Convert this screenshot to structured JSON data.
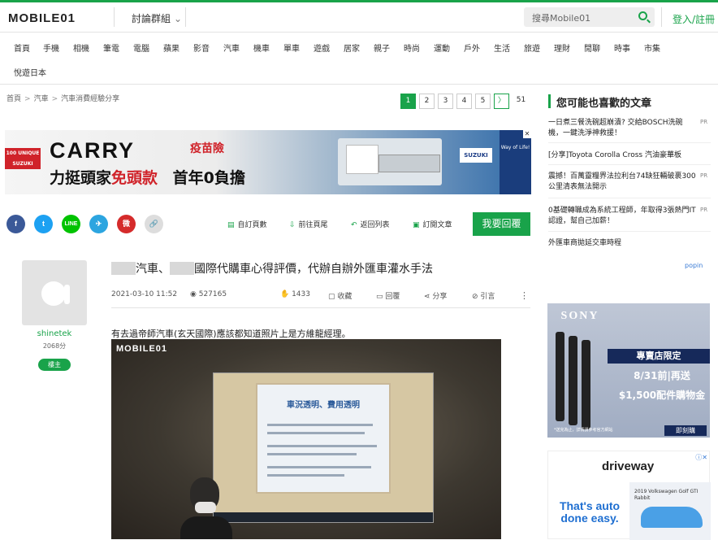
{
  "header": {
    "logo": "MOBILE01",
    "forum_label": "討論群組",
    "search_placeholder": "搜尋Mobile01",
    "login": "登入/註冊"
  },
  "nav": {
    "row1": [
      "首頁",
      "手機",
      "相機",
      "筆電",
      "電腦",
      "蘋果",
      "影音",
      "汽車",
      "機車",
      "單車",
      "遊戲",
      "居家",
      "親子",
      "時尚",
      "運動",
      "戶外",
      "生活",
      "旅遊",
      "理財",
      "閒聊",
      "時事",
      "市集"
    ],
    "row2": [
      "悅遊日本"
    ]
  },
  "breadcrumb": [
    "首頁",
    "汽車",
    "汽車消費經驗分享"
  ],
  "pagination": {
    "pages": [
      "1",
      "2",
      "3",
      "4",
      "5"
    ],
    "next": "〉",
    "last": "51",
    "active": "1"
  },
  "ad_banner": {
    "badge": "100 UNIQUE SUZUKI",
    "headline": "CARRY",
    "sub_a": "力挺頭家",
    "sub_b": "免頭款",
    "sub_c": "首年0負擔",
    "tag": "疫苗險",
    "brand": "SUZUKI",
    "side": "Way of Life!"
  },
  "share": [
    "f",
    "t",
    "LINE",
    "✈",
    "微",
    "🔗"
  ],
  "actions": {
    "custom_page": "自訂頁數",
    "goto_floor": "前往頁尾",
    "back_list": "返回列表",
    "subscribe": "訂閱文章",
    "reply": "我要回覆"
  },
  "author": {
    "name": "shinetek",
    "points": "2068分",
    "role": "樓主"
  },
  "post": {
    "title_a": "汽車、",
    "title_b": "國際代購車心得評價，代辦自辦外匯車灌水手法",
    "date": "2021-03-10 11:52",
    "views": "527165",
    "likes": "1433",
    "favorite": "收藏",
    "reply": "回覆",
    "share": "分享",
    "quote": "引言",
    "text": "有去過帝師汽車(玄天國際)應該都知道照片上是方維龍經理。",
    "photo_watermark": "MOBILE01",
    "slide_title": "車況透明、費用透明"
  },
  "sidebar": {
    "title": "您可能也喜歡的文章",
    "items": [
      {
        "text": "一日煮三餐洗碗超崩潰? 交給BOSCH洗碗機，一鍵洗淨神救援！",
        "pr": "PR"
      },
      {
        "text": "[分享]Toyota Corolla Cross 汽油豪華板",
        "pr": ""
      },
      {
        "text": "震撼！百萬靈糧界法拉利台74缺狂輛破裹300公里清表無法開示",
        "pr": "PR"
      },
      {
        "text": "0基礎轉職成為系統工程師，年取得3張熱門IT認證，幫自己加薪！",
        "pr": "PR"
      },
      {
        "text": "外匯車商拋延交車時程",
        "pr": ""
      }
    ],
    "popin": "popin"
  },
  "ads": {
    "sony": {
      "logo": "SONY",
      "ribbon": "專賣店限定",
      "line1": "8/31前|再送",
      "line2": "$1,500配件購物金",
      "note": "*送完為止，詳情請參考官方網站",
      "cta": "即刻購"
    },
    "driveway": {
      "logo": "driveway",
      "headline": "That's auto done easy.",
      "car_label": "2019 Volkswagen Golf GTI Rabbit"
    }
  }
}
